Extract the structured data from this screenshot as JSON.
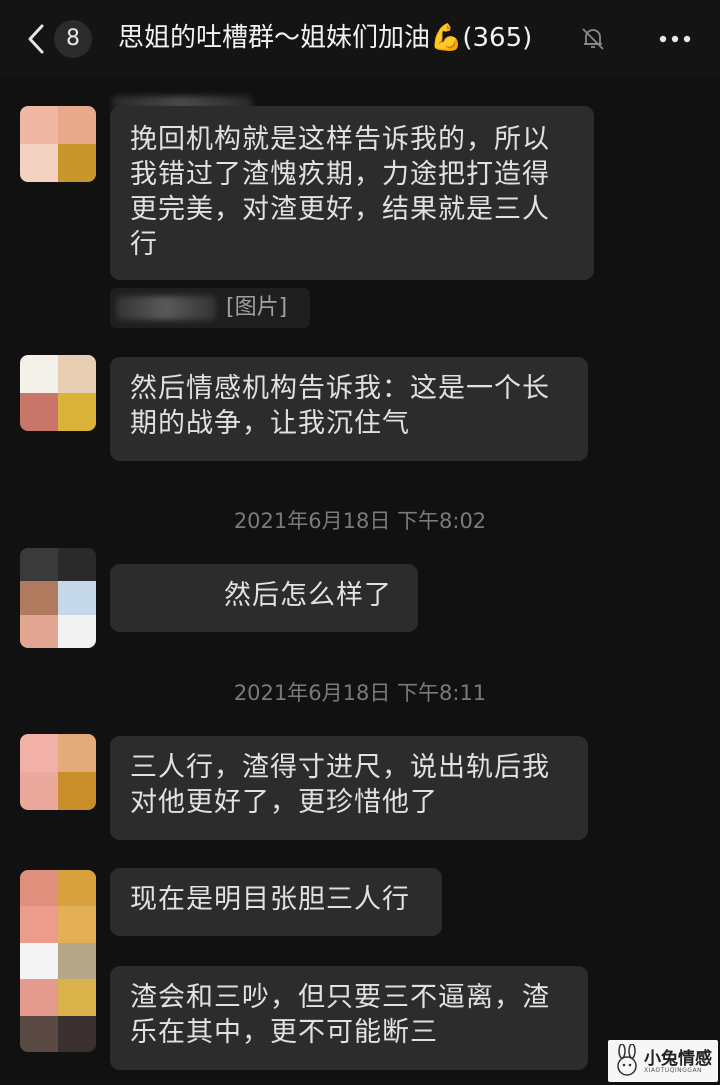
{
  "header": {
    "unread_count": "8",
    "title": "思姐的吐槽群～姐妹们加油💪(365)"
  },
  "messages": [
    {
      "text": "挽回机构就是这样告诉我的，所以我错过了渣愧疚期，力途把打造得更完美，对渣更好，结果就是三人行"
    },
    {
      "quote": "[图片]"
    },
    {
      "text": "然后情感机构告诉我：这是一个长期的战争，让我沉住气"
    },
    {
      "timestamp": "2021年6月18日 下午8:02"
    },
    {
      "text": "然后怎么样了"
    },
    {
      "timestamp": "2021年6月18日 下午8:11"
    },
    {
      "text": "三人行，渣得寸进尺，说出轨后我对他更好了，更珍惜他了"
    },
    {
      "text": "现在是明目张胆三人行"
    },
    {
      "text": "渣会和三吵，但只要三不逼离，渣乐在其中，更不可能断三"
    }
  ],
  "watermark": {
    "title": "小兔情感",
    "subtitle": "XIAOTUQINGGAN"
  },
  "colors": {
    "background": "#111111",
    "bubble": "#2c2c2c",
    "text": "#e1e1e1",
    "timestamp": "#7a7a7a"
  },
  "icons": [
    "back-icon",
    "mute-bell-icon",
    "more-icon",
    "rabbit-logo-icon"
  ]
}
